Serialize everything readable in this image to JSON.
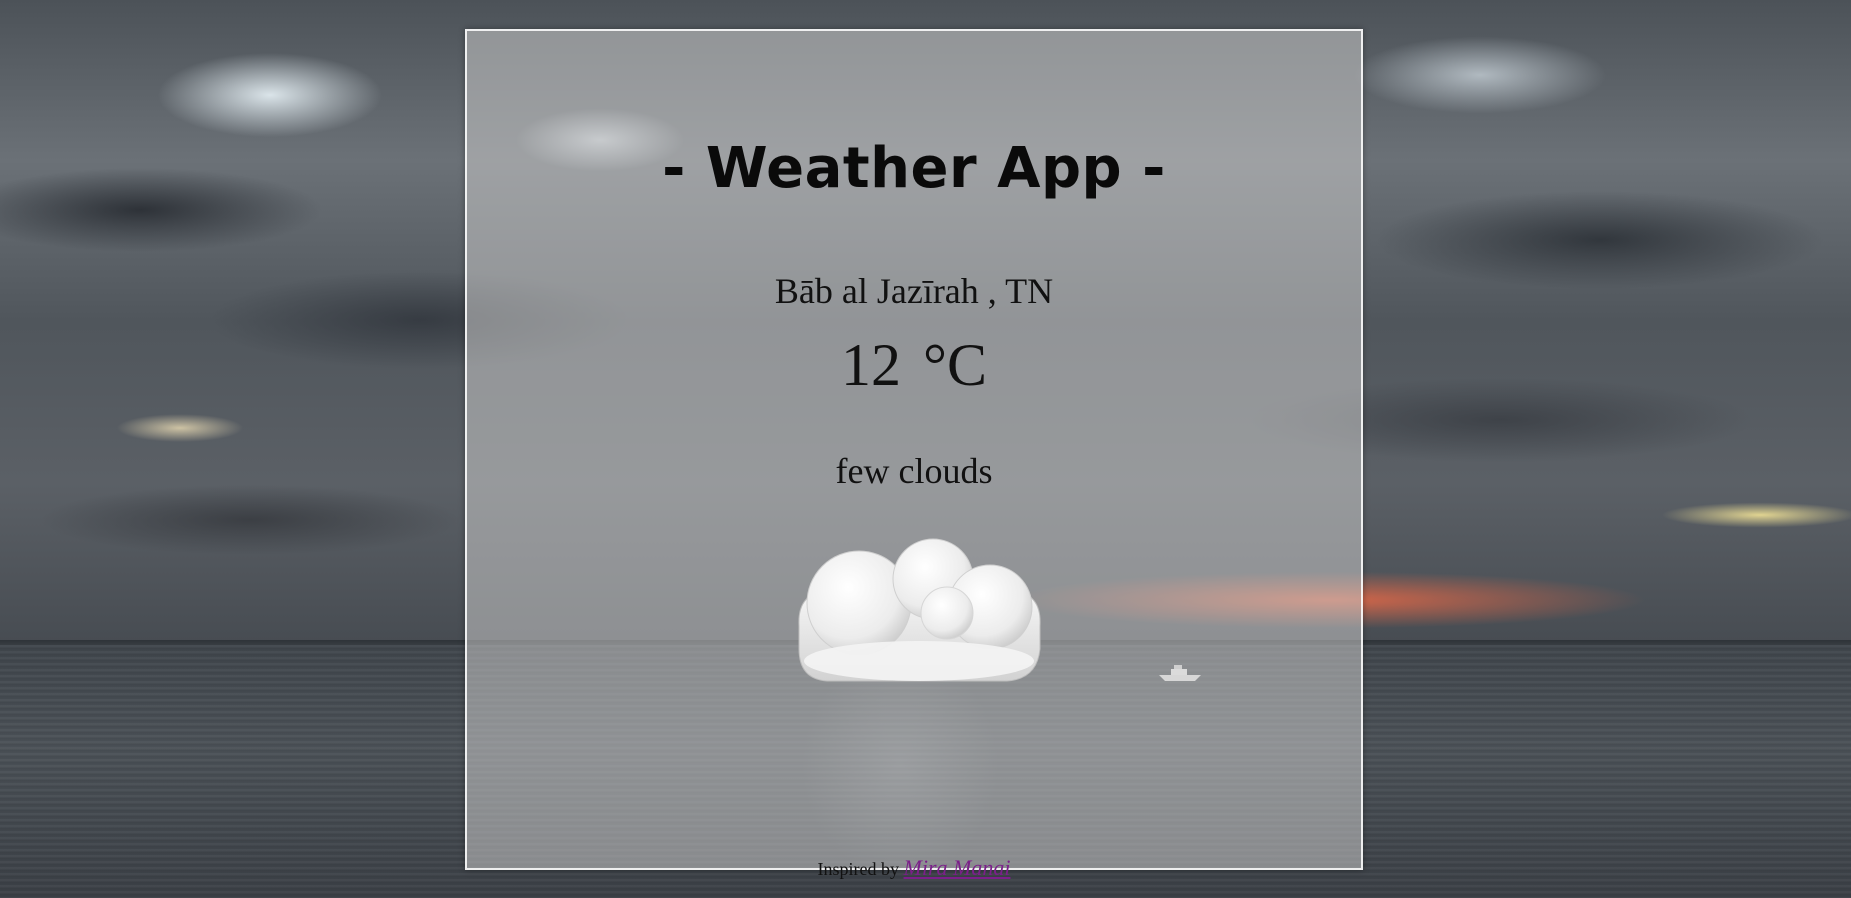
{
  "app": {
    "title": "- Weather App -"
  },
  "weather": {
    "location": "Bāb al Jazīrah , TN",
    "temperature": "12",
    "unit": "°C",
    "description": "few clouds",
    "icon": "cloud-icon"
  },
  "footer": {
    "prefix": "Inspired by",
    "author_link": "Mira Manai"
  },
  "colors": {
    "link": "#7b1f8a",
    "card_border": "#ffffff"
  }
}
